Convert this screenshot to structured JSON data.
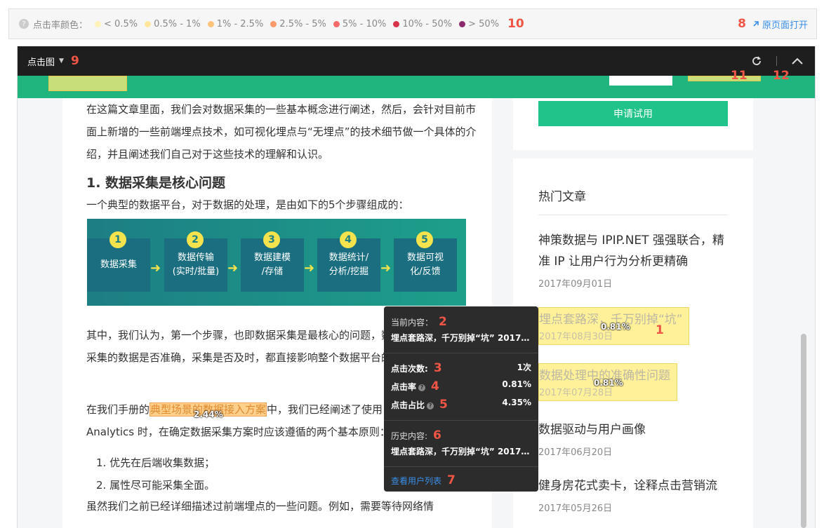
{
  "legend": {
    "label": "点击率颜色：",
    "items": [
      {
        "label": "< 0.5%",
        "color": "#fff2b8"
      },
      {
        "label": "0.5% - 1%",
        "color": "#ffe69a"
      },
      {
        "label": "1% - 2.5%",
        "color": "#ffc27a"
      },
      {
        "label": "2.5% - 5%",
        "color": "#ff9a6a"
      },
      {
        "label": "5% - 10%",
        "color": "#f76a6a"
      },
      {
        "label": "10% - 50%",
        "color": "#d9334a"
      },
      {
        "label": "> 50%",
        "color": "#8e2a6e"
      }
    ],
    "num_10": "10",
    "num_8": "8",
    "open_original": "原页面打开"
  },
  "topbar": {
    "mode": "点击图",
    "num_9": "9",
    "num_11": "11",
    "num_12": "12"
  },
  "article": {
    "p1": "在这篇文章里面，我们会对数据采集的一些基本概念进行阐述，然后，会针对目前市面上新增的一些前端埋点技术，如可视化埋点与“无埋点”的技术细节做一个具体的介绍，并且阐述我们自己对于这些技术的理解和认识。",
    "h1": "1. 数据采集是核心问题",
    "p2": "一个典型的数据平台，对于数据的处理，是由如下的5个步骤组成的：",
    "steps": [
      {
        "num": "1",
        "label": "数据采集"
      },
      {
        "num": "2",
        "label": "数据传输\n(实时/批量)"
      },
      {
        "num": "3",
        "label": "数据建模\n/存储"
      },
      {
        "num": "4",
        "label": "数据统计/\n分析/挖掘"
      },
      {
        "num": "5",
        "label": "数据可视\n化/反馈"
      }
    ],
    "p3": "其中，我们认为，第一个步骤，也即数据采集是最核心的问题，数据采集是否丰富，采集的数据是否准确，采集是否及时，都直接影响整个数据平台的应用的效果。",
    "p4_before": "在我们手册的",
    "p4_link": "典型场景的数据接入方案",
    "p4_pct": "2.44%",
    "p4_after": "中，我们已经阐述了使用 Sensors",
    "p4_line2": "Analytics 时，在确定数据采集方案时应该遵循的两个基本原则：",
    "li1": "1. 优先在后端收集数据；",
    "li2": "2. 属性尽可能采集全面。",
    "p5": "虽然我们之前已经详细描述过前端埋点的一些问题。例如，需要等待网络情"
  },
  "sidebar": {
    "apply_button": "申请试用",
    "hot_title": "热门文章",
    "articles": [
      {
        "title": "神策数据与 IPIP.NET 强强联合，精准 IP 让用户行为分析更精确",
        "date": "2017年09月01日"
      },
      {
        "title": "埋点套路深，千万别掉“坑”",
        "date": "2017年08月30日",
        "pct": "0.81%",
        "num": "1"
      },
      {
        "title": "数据处理中的准确性问题",
        "date": "2017年07月28日",
        "pct": "0.81%"
      },
      {
        "title": "数据驱动与用户画像",
        "date": "2017年06月20日"
      },
      {
        "title": "健身房花式卖卡，诠释点击营销流",
        "date": "2017年05月26日"
      }
    ]
  },
  "tooltip": {
    "current_label": "当前内容：",
    "current_value": "埋点套路深，千万别掉“坑” 2017…",
    "clicks_label": "点击次数:",
    "clicks_value": "1次",
    "rate_label": "点击率",
    "rate_value": "0.81%",
    "share_label": "点击占比",
    "share_value": "4.35%",
    "history_label": "历史内容:",
    "history_value": "埋点套路深，千万别掉“坑” 2017…",
    "user_list_link": "查看用户列表",
    "nums": [
      "2",
      "3",
      "4",
      "5",
      "6",
      "7"
    ]
  }
}
